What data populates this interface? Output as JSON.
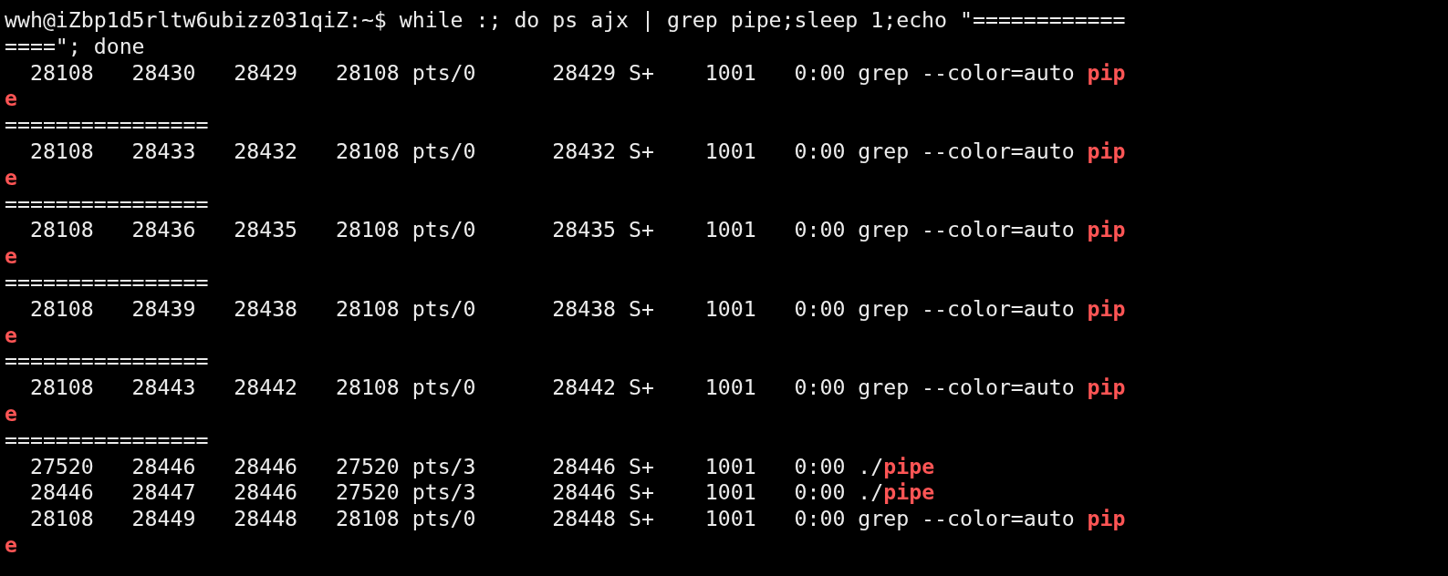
{
  "terminal": {
    "lines": [
      {
        "segments": [
          {
            "text": "wwh@iZbp1d5rltw6ubizz031qiZ:~$ while :; do ps ajx | grep pipe;sleep 1;echo \"============",
            "match": false
          }
        ]
      },
      {
        "segments": [
          {
            "text": "====\"; done",
            "match": false
          }
        ]
      },
      {
        "segments": [
          {
            "text": "  28108   28430   28429   28108 pts/0      28429 S+    1001   0:00 grep --color=auto ",
            "match": false
          },
          {
            "text": "pip",
            "match": true
          }
        ]
      },
      {
        "segments": [
          {
            "text": "e",
            "match": true
          }
        ]
      },
      {
        "segments": [
          {
            "text": "================",
            "match": false
          }
        ]
      },
      {
        "segments": [
          {
            "text": "  28108   28433   28432   28108 pts/0      28432 S+    1001   0:00 grep --color=auto ",
            "match": false
          },
          {
            "text": "pip",
            "match": true
          }
        ]
      },
      {
        "segments": [
          {
            "text": "e",
            "match": true
          }
        ]
      },
      {
        "segments": [
          {
            "text": "================",
            "match": false
          }
        ]
      },
      {
        "segments": [
          {
            "text": "  28108   28436   28435   28108 pts/0      28435 S+    1001   0:00 grep --color=auto ",
            "match": false
          },
          {
            "text": "pip",
            "match": true
          }
        ]
      },
      {
        "segments": [
          {
            "text": "e",
            "match": true
          }
        ]
      },
      {
        "segments": [
          {
            "text": "================",
            "match": false
          }
        ]
      },
      {
        "segments": [
          {
            "text": "  28108   28439   28438   28108 pts/0      28438 S+    1001   0:00 grep --color=auto ",
            "match": false
          },
          {
            "text": "pip",
            "match": true
          }
        ]
      },
      {
        "segments": [
          {
            "text": "e",
            "match": true
          }
        ]
      },
      {
        "segments": [
          {
            "text": "================",
            "match": false
          }
        ]
      },
      {
        "segments": [
          {
            "text": "  28108   28443   28442   28108 pts/0      28442 S+    1001   0:00 grep --color=auto ",
            "match": false
          },
          {
            "text": "pip",
            "match": true
          }
        ]
      },
      {
        "segments": [
          {
            "text": "e",
            "match": true
          }
        ]
      },
      {
        "segments": [
          {
            "text": "================",
            "match": false
          }
        ]
      },
      {
        "segments": [
          {
            "text": "  27520   28446   28446   27520 pts/3      28446 S+    1001   0:00 ./",
            "match": false
          },
          {
            "text": "pipe",
            "match": true
          }
        ]
      },
      {
        "segments": [
          {
            "text": "  28446   28447   28446   27520 pts/3      28446 S+    1001   0:00 ./",
            "match": false
          },
          {
            "text": "pipe",
            "match": true
          }
        ]
      },
      {
        "segments": [
          {
            "text": "  28108   28449   28448   28108 pts/0      28448 S+    1001   0:00 grep --color=auto ",
            "match": false
          },
          {
            "text": "pip",
            "match": true
          }
        ]
      },
      {
        "segments": [
          {
            "text": "e",
            "match": true
          }
        ]
      }
    ]
  }
}
